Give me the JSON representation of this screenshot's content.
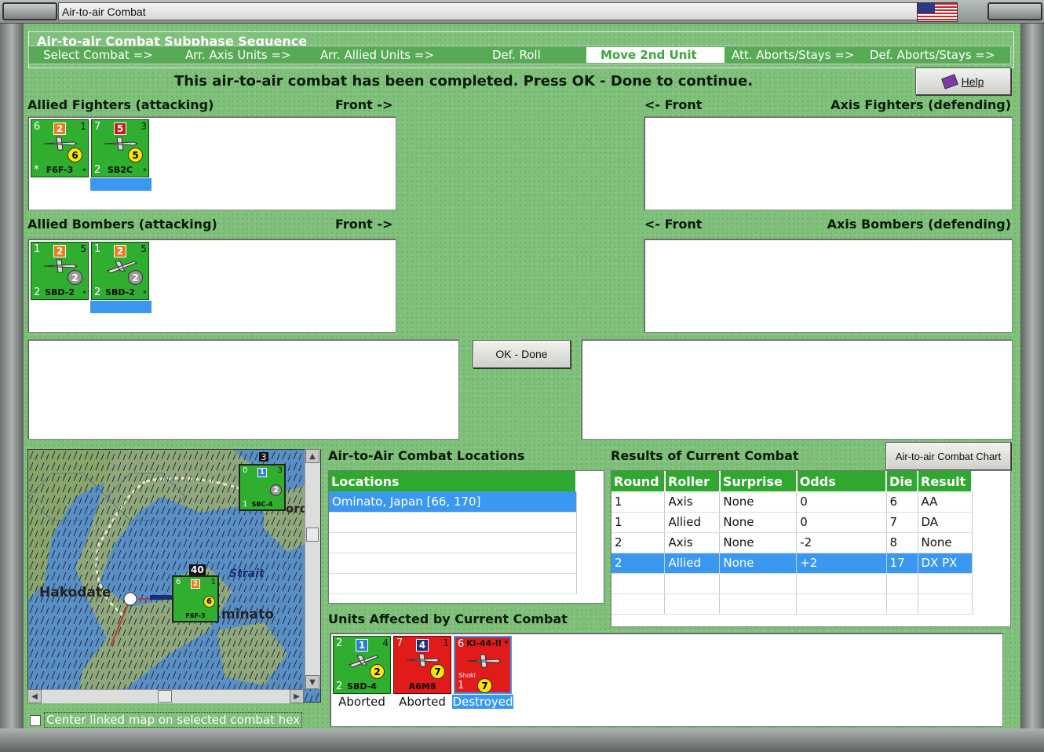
{
  "window": {
    "title": "Air-to-air Combat"
  },
  "sequence": {
    "group_title": "Air-to-air Combat Subphase Sequence",
    "steps": [
      {
        "label": "Select Combat =>"
      },
      {
        "label": "Arr. Axis Units =>"
      },
      {
        "label": "Arr. Allied Units =>"
      },
      {
        "label": "Def. Roll"
      },
      {
        "label": "Move 2nd Unit",
        "active": true
      },
      {
        "label": "Att. Aborts/Stays =>"
      },
      {
        "label": "Def. Aborts/Stays =>"
      }
    ]
  },
  "status_message": "This air-to-air combat has been completed.  Press OK - Done to continue.",
  "help_button": {
    "label": "Help",
    "icon": "help-book-icon"
  },
  "allied_fighters": {
    "title": "Allied Fighters (attacking)",
    "front": "Front ->",
    "units": [
      {
        "name": "F6F-3",
        "tl": "6",
        "tr": "1",
        "bl": "*",
        "br": "*",
        "box": "2",
        "box_color": "orange",
        "circle": "6",
        "circle_color": "yellow",
        "selected": false
      },
      {
        "name": "SB2C",
        "tl": "7",
        "tr": "3",
        "bl": "2",
        "br": "*",
        "box": "5",
        "box_color": "red",
        "circle": "5",
        "circle_color": "yellow",
        "selected": true
      }
    ]
  },
  "axis_fighters": {
    "title": "Axis Fighters (defending)",
    "front": "<- Front"
  },
  "allied_bombers": {
    "title": "Allied Bombers (attacking)",
    "front": "Front ->",
    "units": [
      {
        "name": "SBD-2",
        "tl": "1",
        "tr": "5",
        "bl": "2",
        "br": "*",
        "box": "2",
        "box_color": "orange",
        "circle": "2",
        "circle_color": "gray",
        "selected": false
      },
      {
        "name": "SBD-2",
        "tl": "1",
        "tr": "5",
        "bl": "2",
        "br": "*",
        "box": "2",
        "box_color": "orange",
        "circle": "2",
        "circle_color": "gray",
        "selected": true
      }
    ]
  },
  "axis_bombers": {
    "title": "Axis Bombers (defending)",
    "front": "<- Front"
  },
  "ok_button": {
    "label": "OK - Done"
  },
  "map": {
    "labels": {
      "city": "Hakodate",
      "strait": "Strait",
      "minato": "minato",
      "ord": "ord",
      "stack_top": "3",
      "stack_mid": "40"
    },
    "counter_sbc": {
      "name": "SBC-4",
      "tl": "0",
      "tr": "3",
      "bl": "1",
      "box": "1",
      "circle": "2"
    },
    "counter_f6f": {
      "name": "F6F-3",
      "tl": "6",
      "tr": "1",
      "box": "2",
      "circle": "6"
    },
    "center_checkbox": {
      "label": "Center linked map on selected combat hex",
      "checked": false
    }
  },
  "locations": {
    "title": "Air-to-Air Combat Locations",
    "header": "Locations",
    "rows": [
      "Ominato, Japan [66, 170]",
      "",
      "",
      "",
      ""
    ],
    "selected_index": 0
  },
  "results": {
    "title": "Results of Current Combat",
    "chart_button": "Air-to-air Combat Chart",
    "columns": [
      "Round",
      "Roller",
      "Surprise",
      "Odds",
      "Die",
      "Result"
    ],
    "rows": [
      [
        "1",
        "Axis",
        "None",
        "0",
        "6",
        "AA"
      ],
      [
        "1",
        "Allied",
        "None",
        "0",
        "7",
        "DA"
      ],
      [
        "2",
        "Axis",
        "None",
        "-2",
        "8",
        "None"
      ],
      [
        "2",
        "Allied",
        "None",
        "+2",
        "17",
        "DX PX"
      ],
      [
        "",
        "",
        "",
        "",
        "",
        ""
      ],
      [
        "",
        "",
        "",
        "",
        "",
        ""
      ]
    ],
    "selected_index": 3
  },
  "affected": {
    "title": "Units Affected by Current Combat",
    "units": [
      {
        "name": "SBD-4",
        "tl": "2",
        "tr": "4",
        "bl": "2",
        "br": "",
        "box": "1",
        "box_color": "blue",
        "circle": "2",
        "circle_color": "yellow",
        "color": "green",
        "status": "Aborted",
        "selected": false
      },
      {
        "name": "A6M8",
        "tl": "7",
        "tr": "1",
        "bl": "",
        "br": "",
        "box": "4",
        "box_color": "navy",
        "circle": "7",
        "circle_color": "yellow",
        "color": "red",
        "status": "Aborted",
        "selected": false
      },
      {
        "name": "Ki-44-II",
        "tl": "6",
        "tr": "*",
        "bl": "1",
        "br": "",
        "box": "",
        "box_color": "",
        "circle": "7",
        "circle_color": "yellow",
        "color": "red",
        "status": "Destroyed",
        "sub": "Shoki",
        "selected": true
      }
    ]
  }
}
